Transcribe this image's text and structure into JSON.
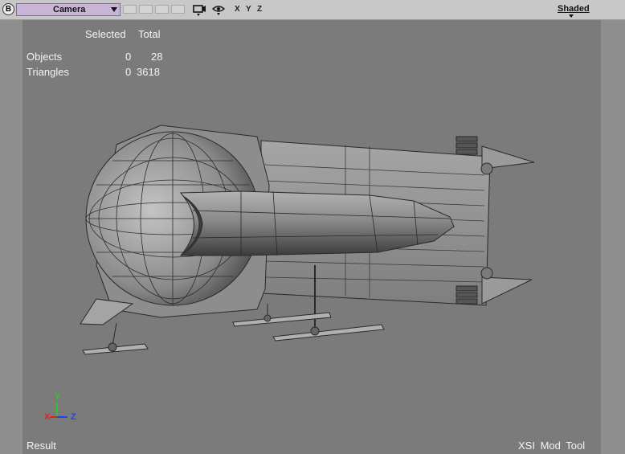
{
  "toolbar": {
    "view_letter": "B",
    "camera_label": "Camera",
    "axis_x": "X",
    "axis_y": "Y",
    "axis_z": "Z",
    "display_mode": "Shaded",
    "icons": [
      "chevron-down-icon",
      "camera-icon",
      "eye-icon"
    ]
  },
  "stats": {
    "col_selected": "Selected",
    "col_total": "Total",
    "rows": [
      {
        "label": "Objects",
        "selected": "0",
        "total": "28"
      },
      {
        "label": "Triangles",
        "selected": "0",
        "total": "3618"
      }
    ]
  },
  "gizmo": {
    "x": "X",
    "y": "Y",
    "z": "Z",
    "x_color": "#e02020",
    "y_color": "#20d020",
    "z_color": "#2040ff"
  },
  "footer": {
    "left": "Result",
    "right": "XSI  Mod  Tool"
  },
  "colors": {
    "toolbar_bg": "#c8c8c8",
    "camera_select": "#c9b6d6",
    "viewport_bg": "#7b7b7b"
  }
}
